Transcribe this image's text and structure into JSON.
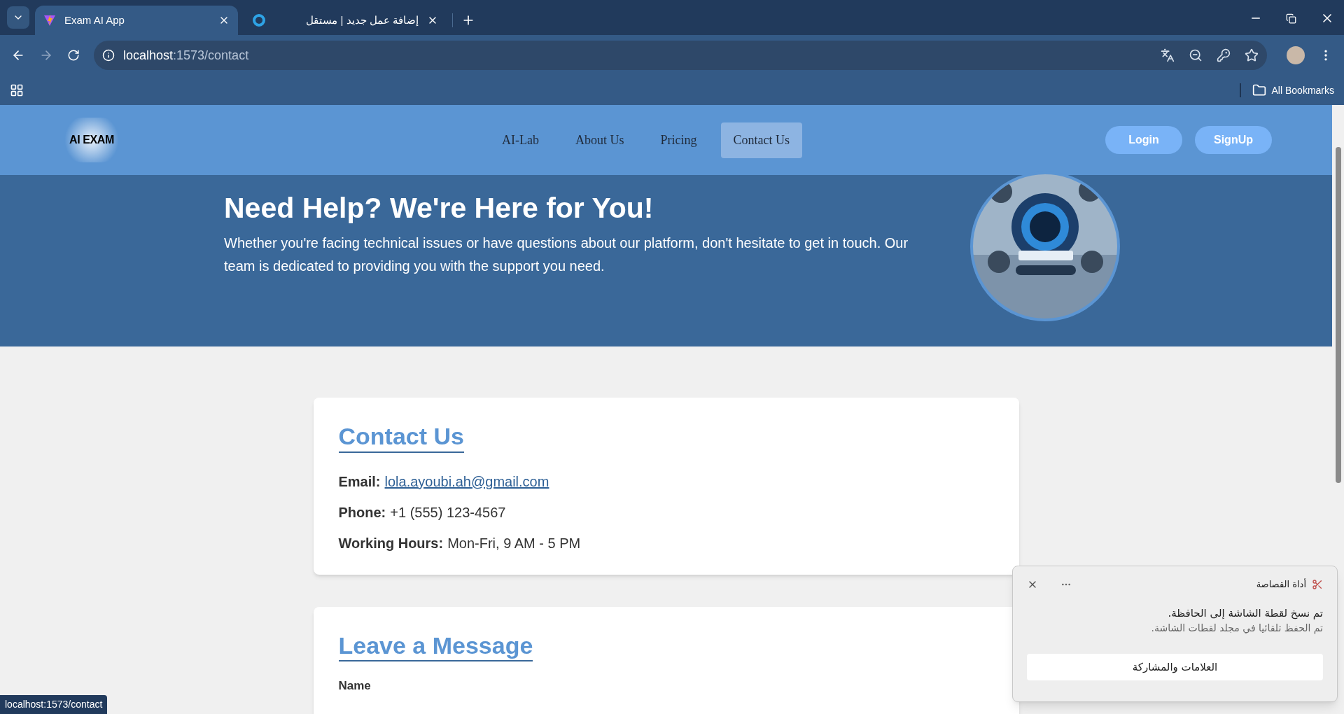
{
  "browser": {
    "tabs": [
      {
        "title": "Exam AI App",
        "selected": true
      },
      {
        "title": "إضافة عمل جديد | مستقل",
        "selected": false
      }
    ],
    "url_host": "localhost",
    "url_path": ":1573/contact",
    "bookmarks": "All Bookmarks"
  },
  "nav": {
    "logo": "AI EXAM",
    "links": [
      {
        "label": "AI-Lab",
        "selected": false
      },
      {
        "label": "About Us",
        "selected": false
      },
      {
        "label": "Pricing",
        "selected": false
      },
      {
        "label": "Contact Us",
        "selected": true
      }
    ],
    "buttons": [
      "Login",
      "SignUp"
    ]
  },
  "hero": {
    "title": "Need Help? We're Here for You!",
    "text": "Whether you're facing technical issues or have questions about our platform, don't hesitate to get in touch. Our team is dedicated to providing you with the support you need."
  },
  "contact": {
    "title": "Contact Us",
    "rows": [
      {
        "label": "Email:",
        "value": "lola.ayoubi.ah@gmail.com",
        "kind": "link"
      },
      {
        "label": "Phone:",
        "value": "+1 (555) 123-4567",
        "kind": "text"
      },
      {
        "label": "Working Hours:",
        "value": "Mon-Fri, 9 AM - 5 PM",
        "kind": "text"
      }
    ]
  },
  "message": {
    "title": "Leave a Message",
    "field_label": "Name"
  },
  "status_url": "localhost:1573/contact",
  "toast": {
    "app": "أداة القصاصة",
    "line1": "تم نسخ لقطة الشاشة إلى الحافظة.",
    "line2": "تم الحفظ تلقائيا في مجلد لقطات الشاشة.",
    "button": "العلامات والمشاركة"
  }
}
